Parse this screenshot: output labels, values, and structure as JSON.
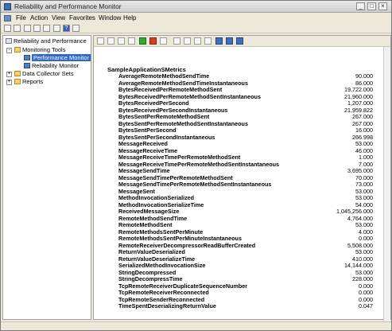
{
  "window": {
    "title": "Reliability and Performance Monitor"
  },
  "menu": {
    "items": [
      {
        "label": "File"
      },
      {
        "label": "Action"
      },
      {
        "label": "View"
      },
      {
        "label": "Favorites"
      },
      {
        "label": "Window"
      },
      {
        "label": "Help"
      }
    ]
  },
  "tree": {
    "items": [
      {
        "label": "Reliability and Performance"
      },
      {
        "label": "Monitoring Tools"
      },
      {
        "label": "Performance Monitor"
      },
      {
        "label": "Reliability Monitor"
      },
      {
        "label": "Data Collector Sets"
      },
      {
        "label": "Reports"
      }
    ]
  },
  "report": {
    "title": "SampleApplicationSMetrics",
    "metrics": [
      {
        "name": "AverageRemoteMethodSendTime",
        "value": "90.000"
      },
      {
        "name": "AverageRemoteMethodSendTimeInstantaneous",
        "value": "86.000"
      },
      {
        "name": "BytesReceivedPerRemoteMethodSent",
        "value": "19,722.000"
      },
      {
        "name": "BytesReceivedPerRemoteMethodSentInstantaneous",
        "value": "21,960.000"
      },
      {
        "name": "BytesReceivedPerSecond",
        "value": "1,207.000"
      },
      {
        "name": "BytesReceivedPerSecondInstantaneous",
        "value": "21,959.822"
      },
      {
        "name": "BytesSentPerRemoteMethodSent",
        "value": "267.000"
      },
      {
        "name": "BytesSentPerRemoteMethodSentInstantaneous",
        "value": "267.000"
      },
      {
        "name": "BytesSentPerSecond",
        "value": "16.000"
      },
      {
        "name": "BytesSentPerSecondInstantaneous",
        "value": "266.998"
      },
      {
        "name": "MessageReceived",
        "value": "53.000"
      },
      {
        "name": "MessageReceiveTime",
        "value": "46.000"
      },
      {
        "name": "MessageReceiveTimePerRemoteMethodSent",
        "value": "1.000"
      },
      {
        "name": "MessageReceiveTimePerRemoteMethodSentInstantaneous",
        "value": "7.000"
      },
      {
        "name": "MessageSendTime",
        "value": "3,695.000"
      },
      {
        "name": "MessageSendTimePerRemoteMethodSent",
        "value": "70.000"
      },
      {
        "name": "MessageSendTimePerRemoteMethodSentInstantaneous",
        "value": "73.000"
      },
      {
        "name": "MessageSent",
        "value": "53.000"
      },
      {
        "name": "MethodInvocationSerialized",
        "value": "53.000"
      },
      {
        "name": "MethodInvocationSerializeTime",
        "value": "54.000"
      },
      {
        "name": "ReceivedMessageSize",
        "value": "1,045,256.000"
      },
      {
        "name": "RemoteMethodSendTime",
        "value": "4,764.000"
      },
      {
        "name": "RemoteMethodSent",
        "value": "53.000"
      },
      {
        "name": "RemoteMethodsSentPerMinute",
        "value": "4.000"
      },
      {
        "name": "RemoteMethodsSentPerMinuteInstantaneous",
        "value": "0.000"
      },
      {
        "name": "RemoteReceiverDecompressorReadBufferCreated",
        "value": "5,508.000"
      },
      {
        "name": "ReturnValueDeserialized",
        "value": "53.000"
      },
      {
        "name": "ReturnValueDeserializeTime",
        "value": "410.000"
      },
      {
        "name": "SerializedMethodInvocationSize",
        "value": "14,144.000"
      },
      {
        "name": "StringDecompressed",
        "value": "53.000"
      },
      {
        "name": "StringDecompressTime",
        "value": "228.000"
      },
      {
        "name": "TcpRemoteReceiverDuplicateSequenceNumber",
        "value": "0.000"
      },
      {
        "name": "TcpRemoteReceiverReconnected",
        "value": "0.000"
      },
      {
        "name": "TcpRemoteSenderReconnected",
        "value": "0.000"
      },
      {
        "name": "TimeSpentDeserializingReturnValue",
        "value": "0.047"
      }
    ]
  }
}
